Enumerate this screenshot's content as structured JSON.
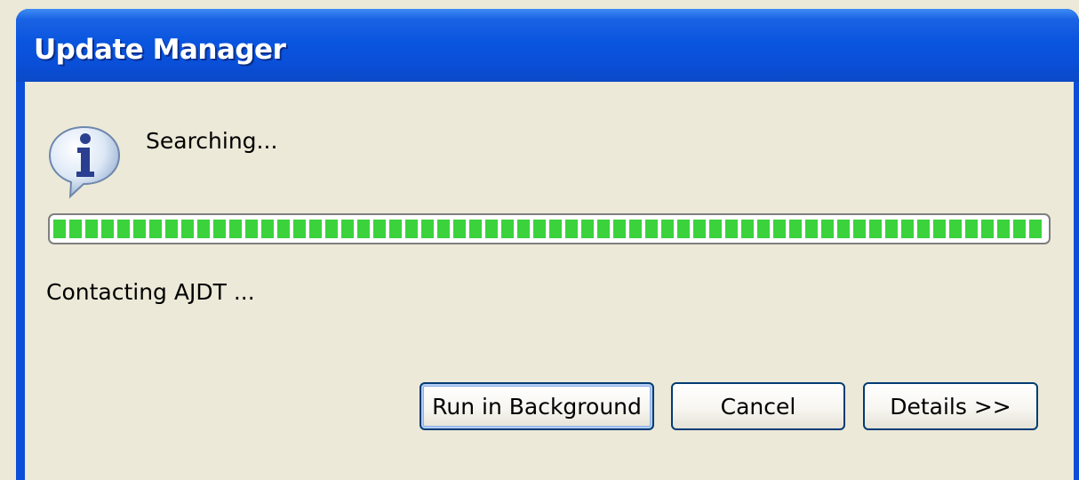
{
  "window": {
    "title": "Update Manager"
  },
  "dialog": {
    "icon": "info-icon",
    "message": "Searching...",
    "progress_fraction": 1.0,
    "status": "Contacting AJDT ..."
  },
  "buttons": {
    "run_in_background": "Run in Background",
    "cancel": "Cancel",
    "details": "Details >>"
  },
  "colors": {
    "titlebar_blue": "#0A4FD8",
    "dialog_background": "#ECE9D8",
    "progress_green": "#3CD23C",
    "button_border": "#003C74"
  }
}
